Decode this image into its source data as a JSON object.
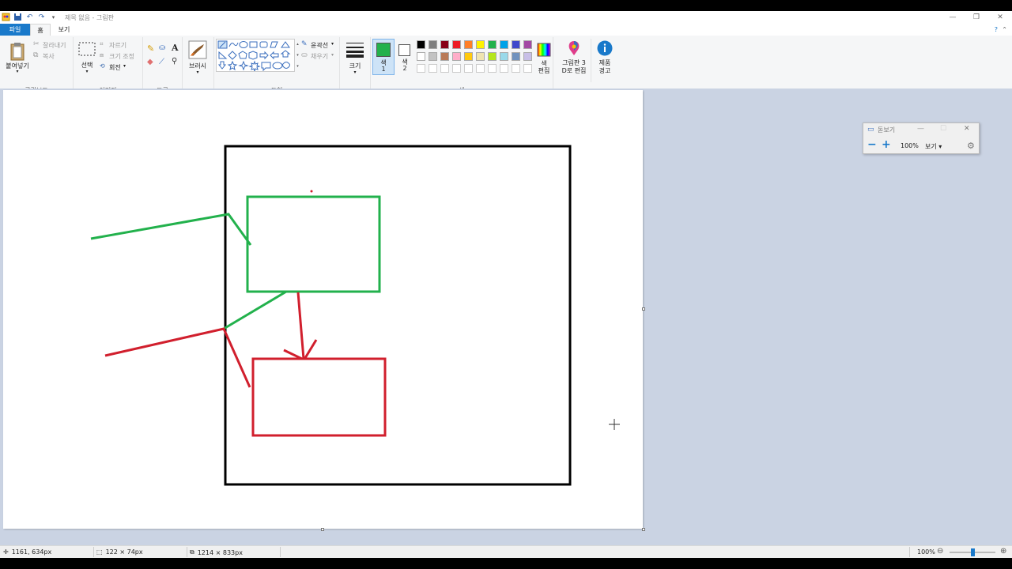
{
  "title_bar": {
    "title": "제목 없음 - 그림판",
    "minimize": "—",
    "restore": "❐",
    "close": "✕"
  },
  "tabs": {
    "file": "파일",
    "home": "홈",
    "view": "보기"
  },
  "ribbon": {
    "clipboard": {
      "paste": "붙여넣기",
      "cut": "잘라내기",
      "copy": "복사",
      "group": "클립보드"
    },
    "image": {
      "select": "선택",
      "crop": "자르기",
      "resize": "크기 조정",
      "rotate": "회전",
      "group": "이미지"
    },
    "tools": {
      "group": "도구"
    },
    "brushes": {
      "label": "브러시"
    },
    "shapes": {
      "outline": "윤곽선",
      "fill": "채우기",
      "group": "도형"
    },
    "size": {
      "label": "크기"
    },
    "colors": {
      "color1": "색\n1",
      "color1_a": "색",
      "color1_b": "1",
      "color2_a": "색",
      "color2_b": "2",
      "edit_a": "색",
      "edit_b": "편집",
      "group": "색",
      "color1_value": "#22b14c",
      "color2_value": "#ffffff",
      "palette_row1": [
        "#000000",
        "#7f7f7f",
        "#880015",
        "#ed1c24",
        "#ff7f27",
        "#fff200",
        "#22b14c",
        "#00a2e8",
        "#3f48cc",
        "#a349a4"
      ],
      "palette_row2": [
        "#ffffff",
        "#c3c3c3",
        "#b97a57",
        "#ffaec9",
        "#ffc90e",
        "#efe4b0",
        "#b5e61d",
        "#99d9ea",
        "#7092be",
        "#c8bfe7"
      ],
      "palette_row3": [
        "#ffffff",
        "#ffffff",
        "#ffffff",
        "#ffffff",
        "#ffffff",
        "#ffffff",
        "#ffffff",
        "#ffffff",
        "#ffffff",
        "#ffffff"
      ]
    },
    "paint3d_a": "그림판 3",
    "paint3d_b": "D로 편집",
    "product_a": "제품",
    "product_b": "경고"
  },
  "navigator": {
    "title": "돋보기",
    "zoom": "100%",
    "view": "보기 ▾"
  },
  "status": {
    "cursor": "1161, 634px",
    "selection": "122 × 74px",
    "canvas_size": "1214 × 833px",
    "zoom": "100%"
  },
  "drawing": {
    "black_rect_color": "#000000",
    "green_color": "#22b14c",
    "red_color": "#d11f2d"
  }
}
